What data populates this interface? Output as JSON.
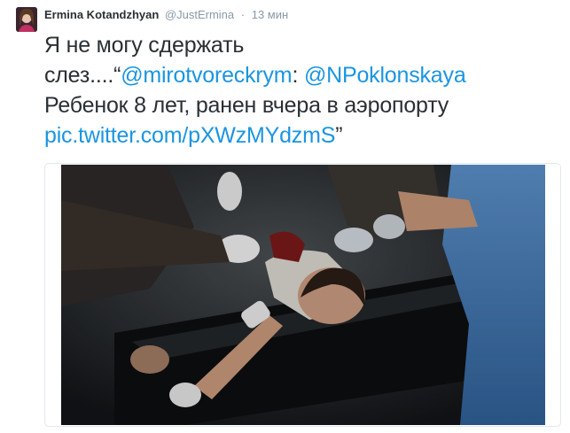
{
  "tweet": {
    "author": {
      "display_name": "Ermina Kotandzhyan",
      "username": "@JustErmina",
      "avatar": "profile-avatar"
    },
    "separator": "·",
    "timestamp": "13 мин",
    "text": {
      "line1": "Я не могу сдержать",
      "line2_prefix": "слез....“",
      "mention1": "@mirotvoreckrym",
      "colon": ":",
      "mention2": "@NPoklonskaya",
      "line3": "Ребенок 8 лет, ранен вчера в аэропорту",
      "link": "pic.twitter.com/pXWzMYdzmS",
      "closing_quote": "”"
    },
    "link_color": "#1b95e0",
    "text_color": "#292f33",
    "meta_color": "#8899a6",
    "media": {
      "type": "photo"
    }
  }
}
